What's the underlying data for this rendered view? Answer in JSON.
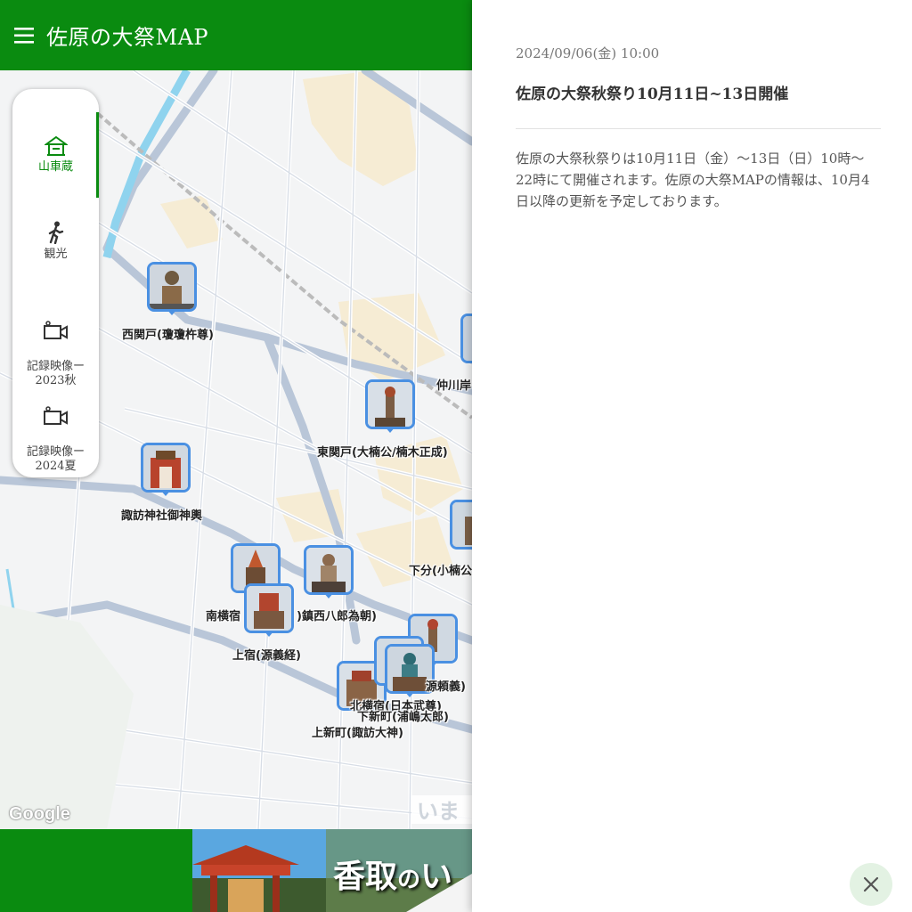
{
  "header": {
    "title": "佐原の大祭MAP"
  },
  "nav": {
    "items": [
      {
        "label": "山車蔵"
      },
      {
        "label": "観光"
      },
      {
        "label": "記録映像ー\n2023秋"
      },
      {
        "label": "記録映像ー\n2024夏"
      }
    ]
  },
  "map": {
    "markers": [
      {
        "label": "西関戸(瓊瓊杵尊)"
      },
      {
        "label": "仲川岸"
      },
      {
        "label": "東関戸(大楠公/楠木正成)"
      },
      {
        "label": "諏訪神社御神輿"
      },
      {
        "label": "下分(小楠公"
      },
      {
        "label": "南横宿"
      },
      {
        "label": ")鎮西八郎為朝)"
      },
      {
        "label": "上宿(源義経)"
      },
      {
        "label": "源頼義)"
      },
      {
        "label": "北横宿(日本武尊)"
      },
      {
        "label": "下新町(浦嶋太郎)"
      },
      {
        "label": "上新町(諏訪大神)"
      }
    ],
    "google_label": "Google",
    "watermark": "いま"
  },
  "banner": {
    "text_main": "香取",
    "text_small": "の",
    "text_tail": "い"
  },
  "news": {
    "date": "2024/09/06(金) 10:00",
    "title": "佐原の大祭秋祭り10月11日~13日開催",
    "body": "佐原の大祭秋祭りは10月11日（金）〜13日（日）10時〜22時にて開催されます。佐原の大祭MAPの情報は、10月4日以降の更新を予定しております。"
  },
  "colors": {
    "brand_green": "#0a8b10",
    "marker_blue": "#4a90e2",
    "close_bg": "#e3f2e3"
  },
  "icons": [
    "menu-icon",
    "shrine-icon",
    "walking-icon",
    "video-camera-icon",
    "close-icon"
  ]
}
